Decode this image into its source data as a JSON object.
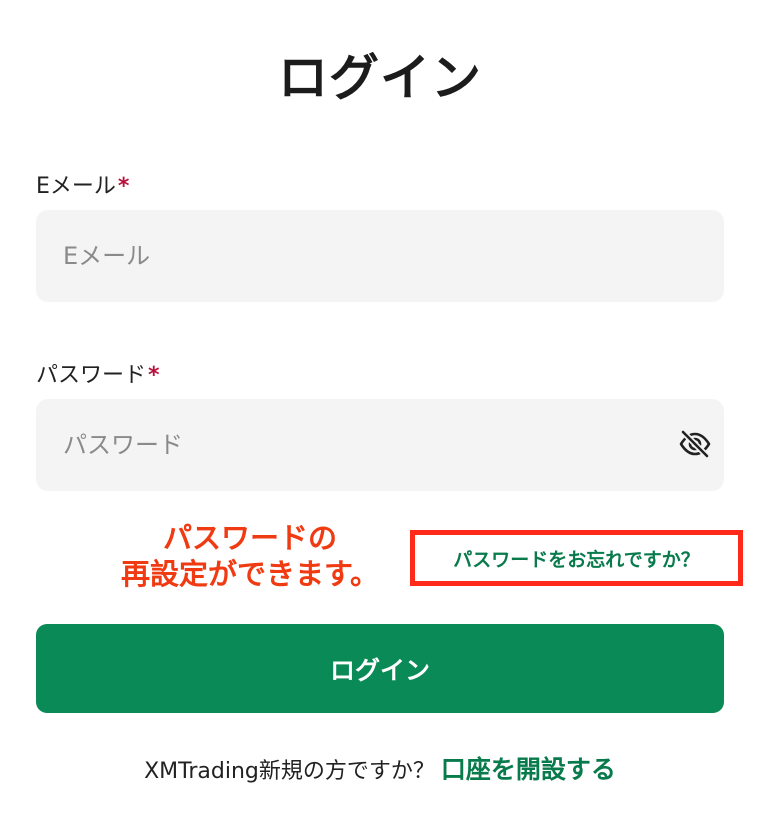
{
  "page": {
    "title": "ログイン"
  },
  "form": {
    "email": {
      "label": "Eメール",
      "required_mark": "*",
      "placeholder": "Eメール",
      "value": ""
    },
    "password": {
      "label": "パスワード",
      "required_mark": "*",
      "placeholder": "パスワード",
      "value": "",
      "toggle_icon": "eye-off-icon"
    },
    "forgot_password_link": "パスワードをお忘れですか？",
    "login_button": "ログイン"
  },
  "annotation": {
    "line1": "パスワードの",
    "line2": "再設定ができます。",
    "color": "#f03a12",
    "highlight_color": "#ff2a1a"
  },
  "footer": {
    "prompt": "XMTrading新規の方ですか？",
    "signup_link": "口座を開設する"
  },
  "colors": {
    "primary": "#0a8a56",
    "link": "#087a4c",
    "required": "#b8123b",
    "input_bg": "#f4f4f4"
  }
}
